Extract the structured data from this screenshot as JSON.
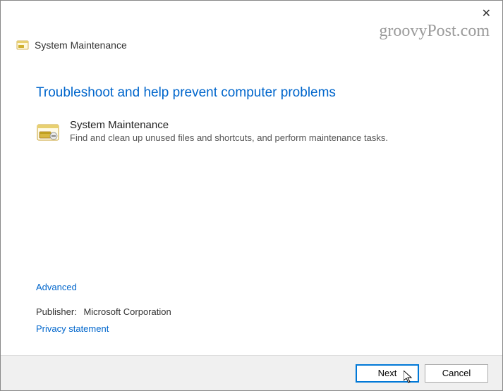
{
  "titlebar": {
    "close_icon": "close-icon"
  },
  "watermark": "groovyPost.com",
  "header": {
    "title": "System Maintenance"
  },
  "main": {
    "heading": "Troubleshoot and help prevent computer problems",
    "item": {
      "title": "System Maintenance",
      "description": "Find and clean up unused files and shortcuts, and perform maintenance tasks."
    }
  },
  "links": {
    "advanced": "Advanced",
    "publisher_label": "Publisher:",
    "publisher_name": "Microsoft Corporation",
    "privacy": "Privacy statement"
  },
  "buttons": {
    "next": "Next",
    "cancel": "Cancel"
  }
}
